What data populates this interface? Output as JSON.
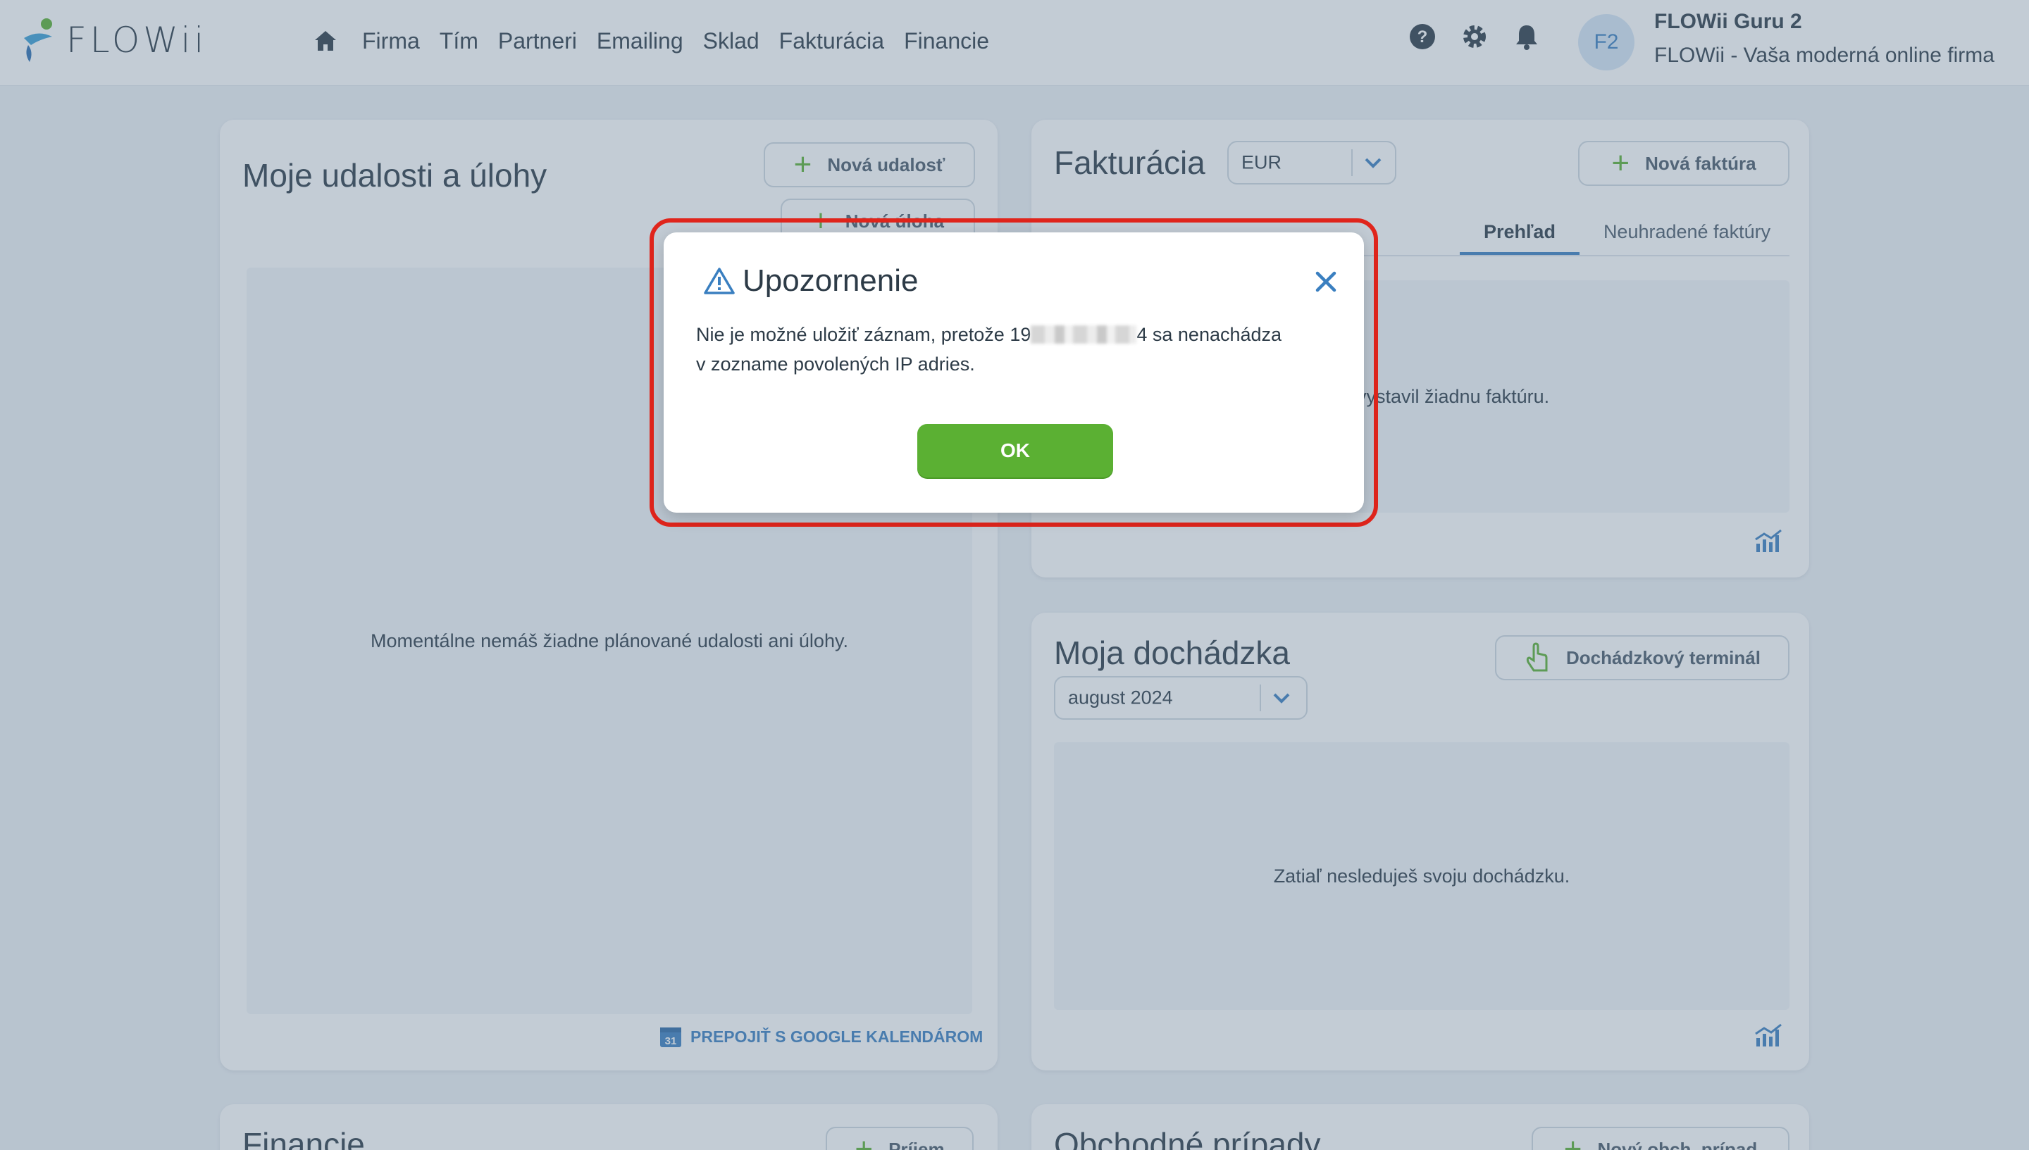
{
  "header": {
    "logo_text": "FLOWii",
    "nav": [
      "Firma",
      "Tím",
      "Partneri",
      "Emailing",
      "Sklad",
      "Fakturácia",
      "Financie"
    ],
    "avatar_initials": "F2",
    "user_name": "FLOWii Guru 2",
    "company": "FLOWii - Vaša moderná online firma"
  },
  "events_card": {
    "title": "Moje udalosti a úlohy",
    "new_event": "Nová udalosť",
    "new_task": "Nová úloha",
    "empty": "Momentálne nemáš žiadne plánované udalosti ani úlohy.",
    "google_link": "PREPOJIŤ S GOOGLE KALENDÁROM"
  },
  "invoice_card": {
    "title": "Fakturácia",
    "currency": "EUR",
    "new_invoice": "Nová faktúra",
    "tabs": [
      "Prehľad",
      "Neuhradené faktúry"
    ],
    "empty_visible": "vystavil žiadnu faktúru."
  },
  "attendance_card": {
    "title": "Moja dochádzka",
    "terminal": "Dochádzkový terminál",
    "month": "august 2024",
    "empty": "Zatiaľ nesleduješ svoju dochádzku."
  },
  "finance_card": {
    "title": "Financie",
    "button": "Príjem"
  },
  "cases_card": {
    "title": "Obchodné prípady",
    "button": "Nový obch. prípad"
  },
  "modal": {
    "title": "Upozornenie",
    "msg_prefix": "Nie je možné uložiť záznam, pretože 19",
    "msg_suffix": "4 sa nenachádza",
    "msg_line2": "v zozname povolených IP adries.",
    "ok": "OK"
  },
  "colors": {
    "accent": "#3a7fc0",
    "green": "#5bb033",
    "highlight": "#e0251c"
  }
}
